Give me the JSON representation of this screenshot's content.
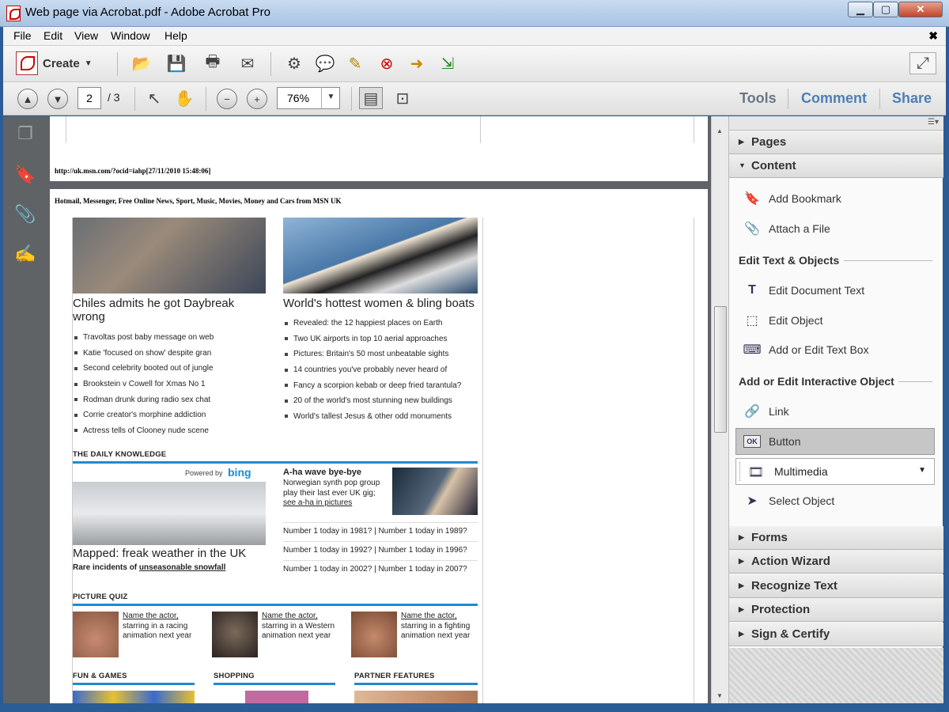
{
  "window": {
    "title": "Web page via Acrobat.pdf - Adobe Acrobat Pro"
  },
  "menu": {
    "items": [
      "File",
      "Edit",
      "View",
      "Window",
      "Help"
    ],
    "close": "✖"
  },
  "toolbar": {
    "create_label": "Create"
  },
  "nav": {
    "current_page": "2",
    "total_pages": "/ 3",
    "zoom": "76%"
  },
  "pane_tabs": {
    "tools": "Tools",
    "comment": "Comment",
    "share": "Share"
  },
  "document": {
    "page1_url": "http://uk.msn.com/?ocid=iahp[27/11/2010 15:48:06]",
    "page2_header": "Hotmail, Messenger, Free Online News, Sport, Music, Movies, Money and Cars from MSN UK",
    "story1": {
      "headline": "Chiles admits he got Daybreak wrong",
      "bullets": [
        "Travoltas post baby message on web",
        "Katie 'focused on show' despite gran",
        "Second celebrity booted out of jungle",
        "Brookstein v Cowell for Xmas No 1",
        "Rodman drunk during radio sex chat",
        "Corrie creator's morphine addiction",
        "Actress tells of Clooney nude scene"
      ]
    },
    "story2": {
      "headline": "World's hottest women & bling boats",
      "bullets": [
        "Revealed: the 12 happiest places on Earth",
        "Two UK airports in top 10 aerial approaches",
        "Pictures: Britain's 50 most unbeatable sights",
        "14 countries you've probably never heard of",
        "Fancy a scorpion kebab or deep fried tarantula?",
        "20 of the world's most stunning new buildings",
        "World's tallest Jesus & other odd monuments"
      ]
    },
    "daily_knowledge": {
      "title": "THE DAILY KNOWLEDGE",
      "powered_by": "Powered by",
      "bing": "bing",
      "mapped_headline": "Mapped: freak weather in the UK",
      "mapped_sub": "Rare incidents of",
      "mapped_link": "unseasonable snowfall",
      "aha_title": "A-ha wave bye-bye",
      "aha_text": "Norwegian synth pop group play their last ever UK gig;",
      "aha_link": "see a-ha in pictures",
      "number1": [
        "Number 1 today in 1981? | Number 1 today in 1989?",
        "Number 1 today in 1992? | Number 1 today in 1996?",
        "Number 1 today in 2002? | Number 1 today in 2007?"
      ]
    },
    "picture_quiz": {
      "title": "PICTURE QUIZ",
      "items": [
        {
          "link": "Name the actor,",
          "text": "starring in a racing animation next year"
        },
        {
          "link": "Name the actor,",
          "text": "starring in a Western animation next year"
        },
        {
          "link": "Name the actor,",
          "text": "starring in a fighting animation next year"
        }
      ]
    },
    "bottom_sections": [
      "FUN & GAMES",
      "SHOPPING",
      "PARTNER FEATURES"
    ]
  },
  "panel": {
    "pages": "Pages",
    "content": "Content",
    "add_bookmark": "Add Bookmark",
    "attach_file": "Attach a File",
    "edit_group": "Edit Text & Objects",
    "edit_doc_text": "Edit Document Text",
    "edit_object": "Edit Object",
    "add_text_box": "Add or Edit Text Box",
    "interactive_group": "Add or Edit Interactive Object",
    "link": "Link",
    "button": "Button",
    "multimedia": "Multimedia",
    "select_object": "Select Object",
    "forms": "Forms",
    "action_wizard": "Action Wizard",
    "recognize_text": "Recognize Text",
    "protection": "Protection",
    "sign_certify": "Sign & Certify"
  },
  "colors": {
    "accent_blue": "#1e8ad0",
    "active_tab": "#4f7eb3",
    "nav_bg": "#5f6366"
  }
}
